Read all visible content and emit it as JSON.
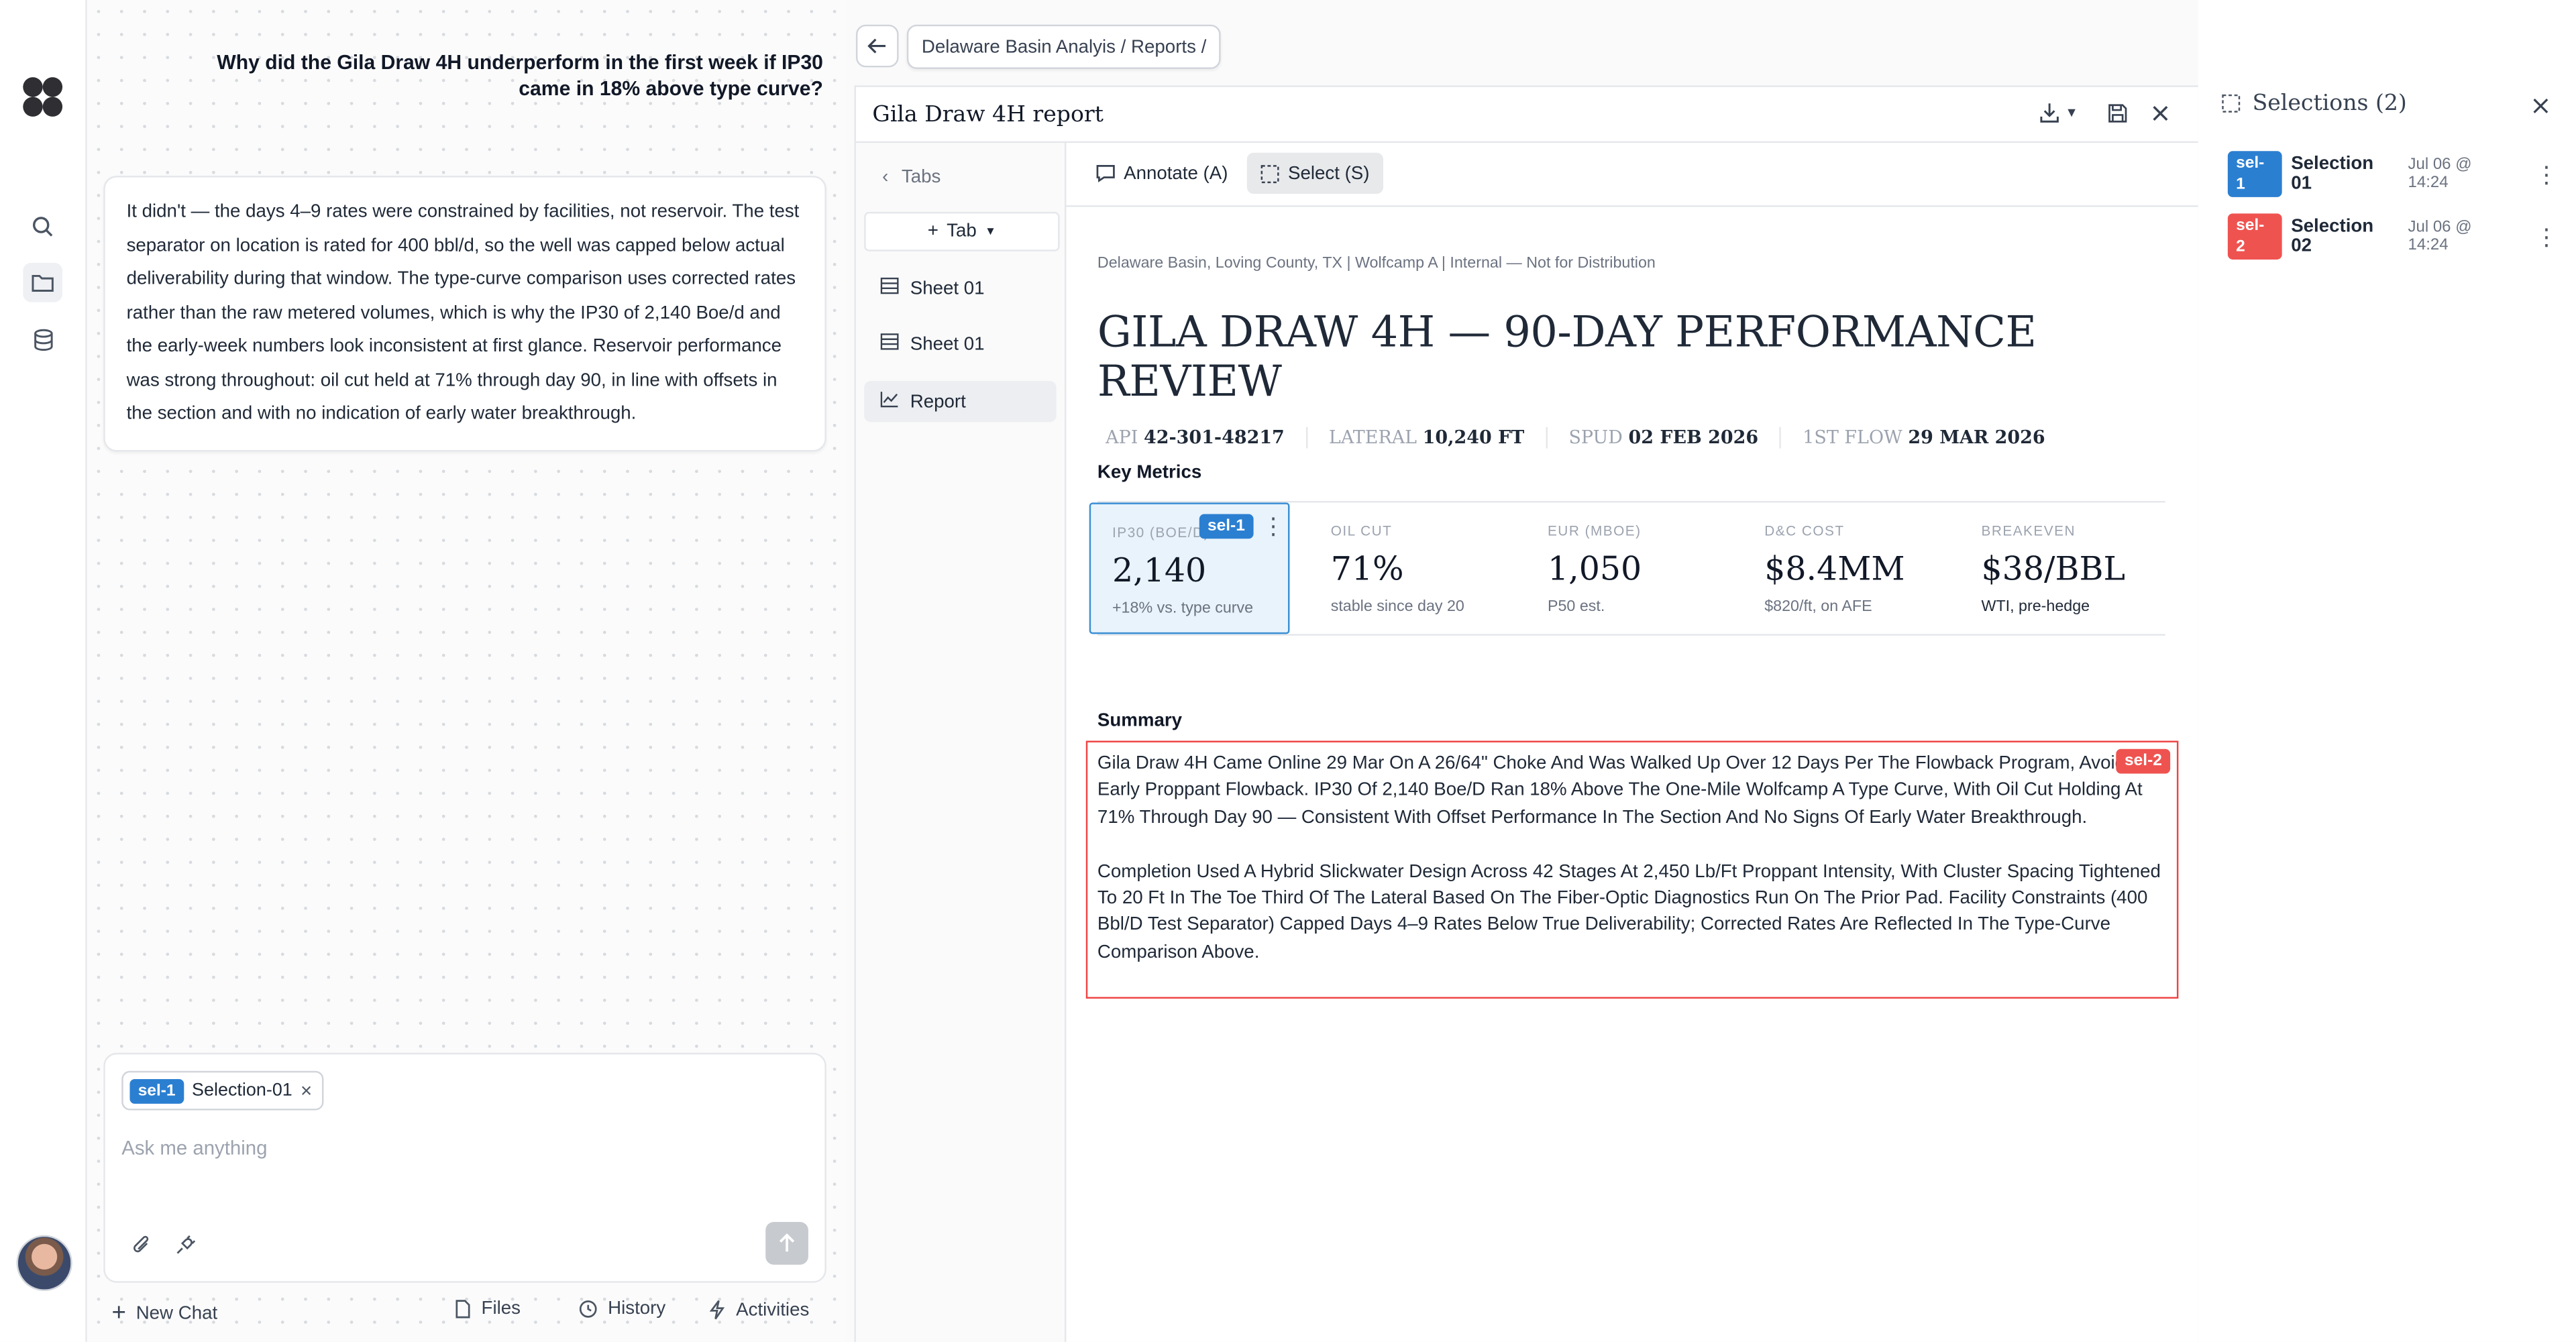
{
  "colors": {
    "tag_blue": "#2b7fd1",
    "tag_red": "#ef5350",
    "selected_fill": "#e8f3fb",
    "selected_border": "#3b8fd6",
    "summary_border": "#ef4444"
  },
  "chat": {
    "question": "Why did the Gila Draw 4H underperform in the first week if IP30 came in 18% above type curve?",
    "answer": "It didn't — the days 4–9 rates were constrained by facilities, not reservoir. The test separator on location is rated for 400 bbl/d, so the well was capped below actual deliverability during that window. The type-curve comparison uses corrected rates rather than the raw metered volumes, which is why the IP30 of 2,140 Boe/d and the early-week numbers look inconsistent at first glance. Reservoir performance was strong throughout: oil cut held at 71% through day 90, in line with offsets in the section and with no indication of early water breakthrough.",
    "chip_tag": "sel-1",
    "chip_label": "Selection-01",
    "placeholder": "Ask me anything",
    "footer": {
      "new_chat": "New Chat",
      "files": "Files",
      "history": "History",
      "activities": "Activities"
    }
  },
  "breadcrumb": "Delaware Basin Analyis / Reports /",
  "panel": {
    "title": "Gila Draw 4H report",
    "tabs_label": "Tabs",
    "add_tab_label": "Tab",
    "tabs": [
      "Sheet 01",
      "Sheet 01",
      "Report"
    ],
    "toolbar": {
      "annotate": "Annotate (A)",
      "select": "Select (S)"
    }
  },
  "report": {
    "meta": "Delaware Basin, Loving County, TX | Wolfcamp A | Internal — Not for Distribution",
    "title": "GILA DRAW 4H — 90-DAY PERFORMANCE REVIEW",
    "stats": [
      {
        "label": "API",
        "value": "42-301-48217"
      },
      {
        "label": "LATERAL",
        "value": "10,240 FT"
      },
      {
        "label": "SPUD",
        "value": "02 FEB 2026"
      },
      {
        "label": "1ST FLOW",
        "value": "29 MAR 2026"
      }
    ],
    "key_metrics_heading": "Key Metrics",
    "metrics": [
      {
        "label": "IP30 (BOE/D)",
        "value": "2,140",
        "sub": "+18% vs. type curve"
      },
      {
        "label": "OIL CUT",
        "value": "71%",
        "sub": "stable since day 20"
      },
      {
        "label": "EUR (MBOE)",
        "value": "1,050",
        "sub": "P50 est."
      },
      {
        "label": "D&C COST",
        "value": "$8.4MM",
        "sub": "$820/ft, on AFE"
      },
      {
        "label": "BREAKEVEN",
        "value": "$38/BBL",
        "sub": "WTI, pre-hedge"
      }
    ],
    "metric_tag": "sel-1",
    "summary_heading": "Summary",
    "summary_tag": "sel-2",
    "summary_p1": "Gila Draw 4H Came Online 29 Mar On A 26/64\" Choke And Was Walked Up Over 12 Days Per The Flowback Program, Avoiding Early Proppant Flowback. IP30 Of 2,140 Boe/D Ran 18% Above The One-Mile Wolfcamp A Type Curve, With Oil Cut Holding At 71% Through Day 90 — Consistent With Offset Performance In The Section And No Signs Of Early Water Breakthrough.",
    "summary_p2": "Completion Used A Hybrid Slickwater Design Across 42 Stages At 2,450 Lb/Ft Proppant Intensity, With Cluster Spacing Tightened To 20 Ft In The Toe Third Of The Lateral Based On The Fiber-Optic Diagnostics Run On The Prior Pad. Facility Constraints (400 Bbl/D Test Separator) Capped Days 4–9 Rates Below True Deliverability; Corrected Rates Are Reflected In The Type-Curve Comparison Above."
  },
  "selections": {
    "title": "Selections (2)",
    "items": [
      {
        "tag": "sel-1",
        "name": "Selection 01",
        "time": "Jul 06 @ 14:24"
      },
      {
        "tag": "sel-2",
        "name": "Selection 02",
        "time": "Jul 06 @ 14:24"
      }
    ]
  }
}
